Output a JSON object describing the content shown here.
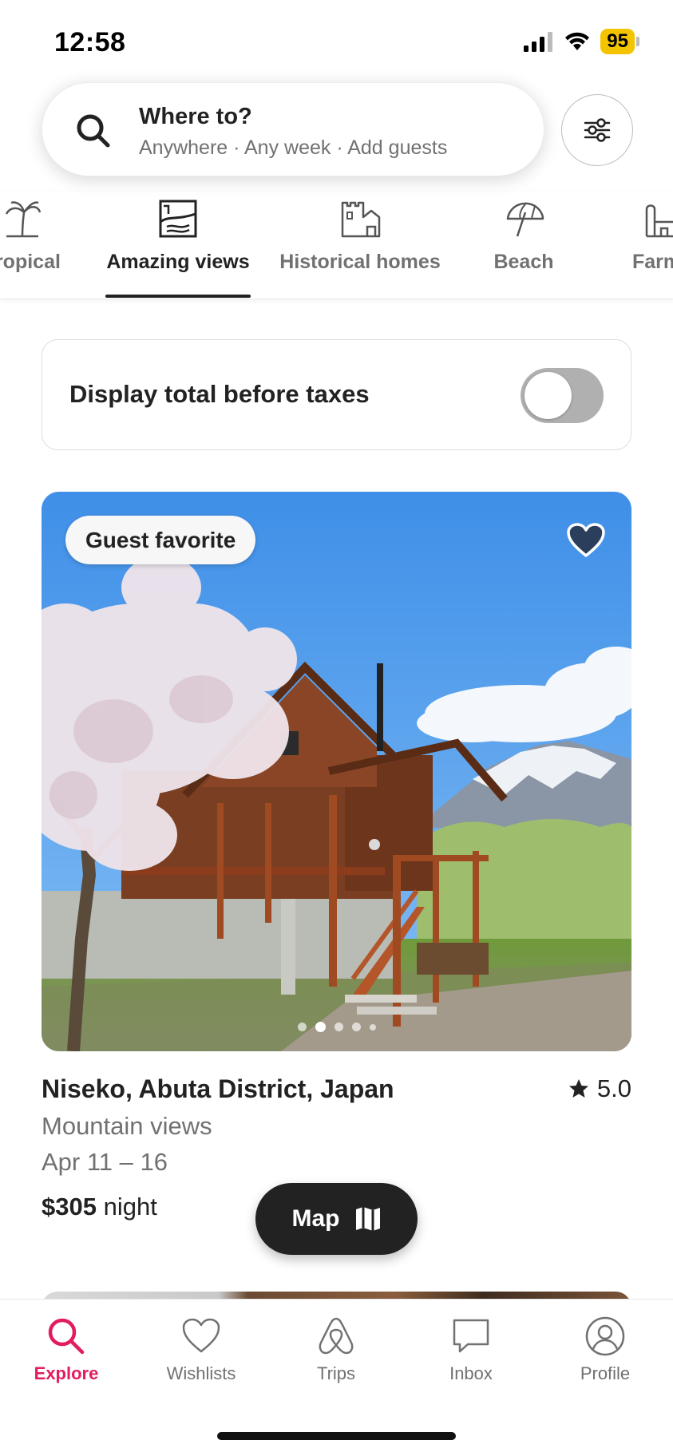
{
  "status_bar": {
    "time": "12:58",
    "battery": "95"
  },
  "search": {
    "title": "Where to?",
    "subtitle": "Anywhere · Any week · Add guests"
  },
  "categories": [
    {
      "label": "Tropical",
      "icon": "palm-tree-icon"
    },
    {
      "label": "Amazing views",
      "icon": "framed-view-icon",
      "active": true
    },
    {
      "label": "Historical homes",
      "icon": "castle-icon"
    },
    {
      "label": "Beach",
      "icon": "umbrella-icon"
    },
    {
      "label": "Farms",
      "icon": "farm-icon"
    }
  ],
  "tax_toggle": {
    "label": "Display total before taxes",
    "on": false
  },
  "listing": {
    "badge": "Guest favorite",
    "location": "Niseko, Abuta District, Japan",
    "rating": "5.0",
    "subtitle": "Mountain views",
    "dates": "Apr 11 – 16",
    "price": "$305",
    "price_unit": "night",
    "saved": true,
    "photo_count": 5,
    "current_photo": 2
  },
  "map_button": {
    "label": "Map"
  },
  "bottom_nav": [
    {
      "label": "Explore",
      "icon": "search-icon",
      "active": true
    },
    {
      "label": "Wishlists",
      "icon": "heart-icon"
    },
    {
      "label": "Trips",
      "icon": "airbnb-logo-icon"
    },
    {
      "label": "Inbox",
      "icon": "message-icon"
    },
    {
      "label": "Profile",
      "icon": "profile-icon"
    }
  ],
  "colors": {
    "brand": "#E31C5F",
    "text": "#222222",
    "muted": "#717171",
    "heart_fill": "#2B3F5C",
    "battery": "#F5C400"
  }
}
